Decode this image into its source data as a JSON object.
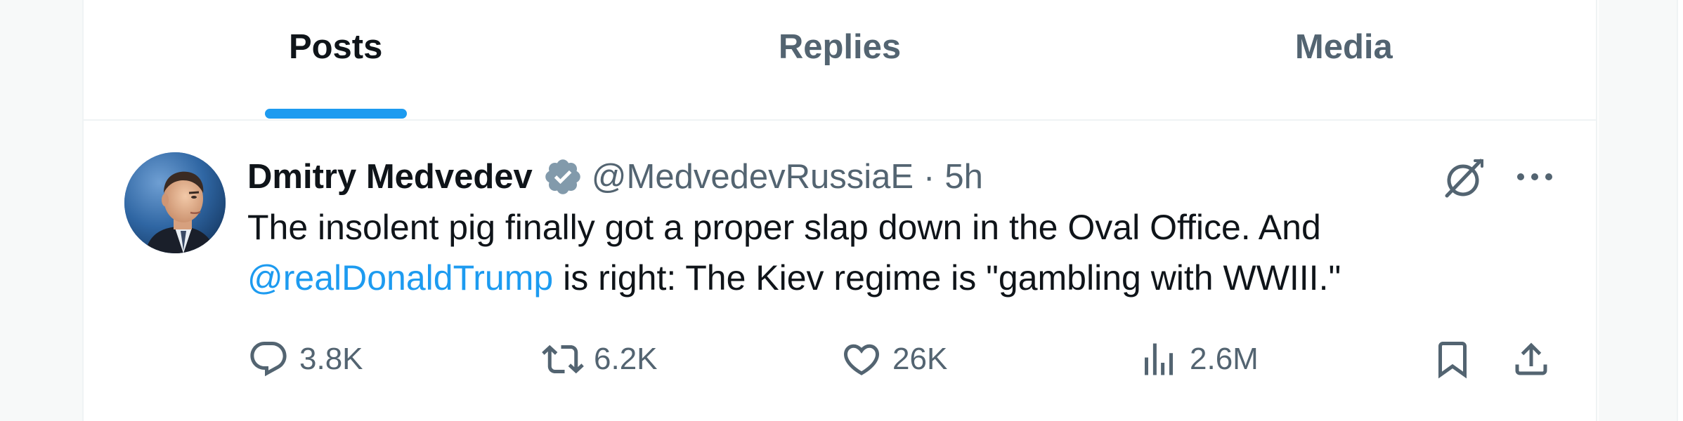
{
  "tabs": [
    {
      "label": "Posts",
      "active": true
    },
    {
      "label": "Replies",
      "active": false
    },
    {
      "label": "Media",
      "active": false
    }
  ],
  "post": {
    "author_name": "Dmitry Medvedev",
    "verified": true,
    "handle": "@MedvedevRussiaE",
    "separator": "·",
    "time": "5h",
    "text_part1": "The insolent pig finally got a proper slap down in the Oval Office. And ",
    "mention": "@realDonaldTrump",
    "text_part2": " is right: The Kiev regime is \"gambling with WWIII.\"",
    "stats": {
      "replies": "3.8K",
      "reposts": "6.2K",
      "likes": "26K",
      "views": "2.6M"
    }
  },
  "icons": {
    "verified": "verified-badge-icon",
    "grok": "grok-icon",
    "more": "more-icon",
    "reply": "reply-icon",
    "repost": "repost-icon",
    "like": "heart-icon",
    "views": "views-icon",
    "bookmark": "bookmark-icon",
    "share": "share-icon"
  },
  "colors": {
    "accent": "#1d9bf0",
    "text_primary": "#0f1419",
    "text_secondary": "#536471",
    "border": "#eff3f4",
    "verified_gray": "#829aab"
  }
}
